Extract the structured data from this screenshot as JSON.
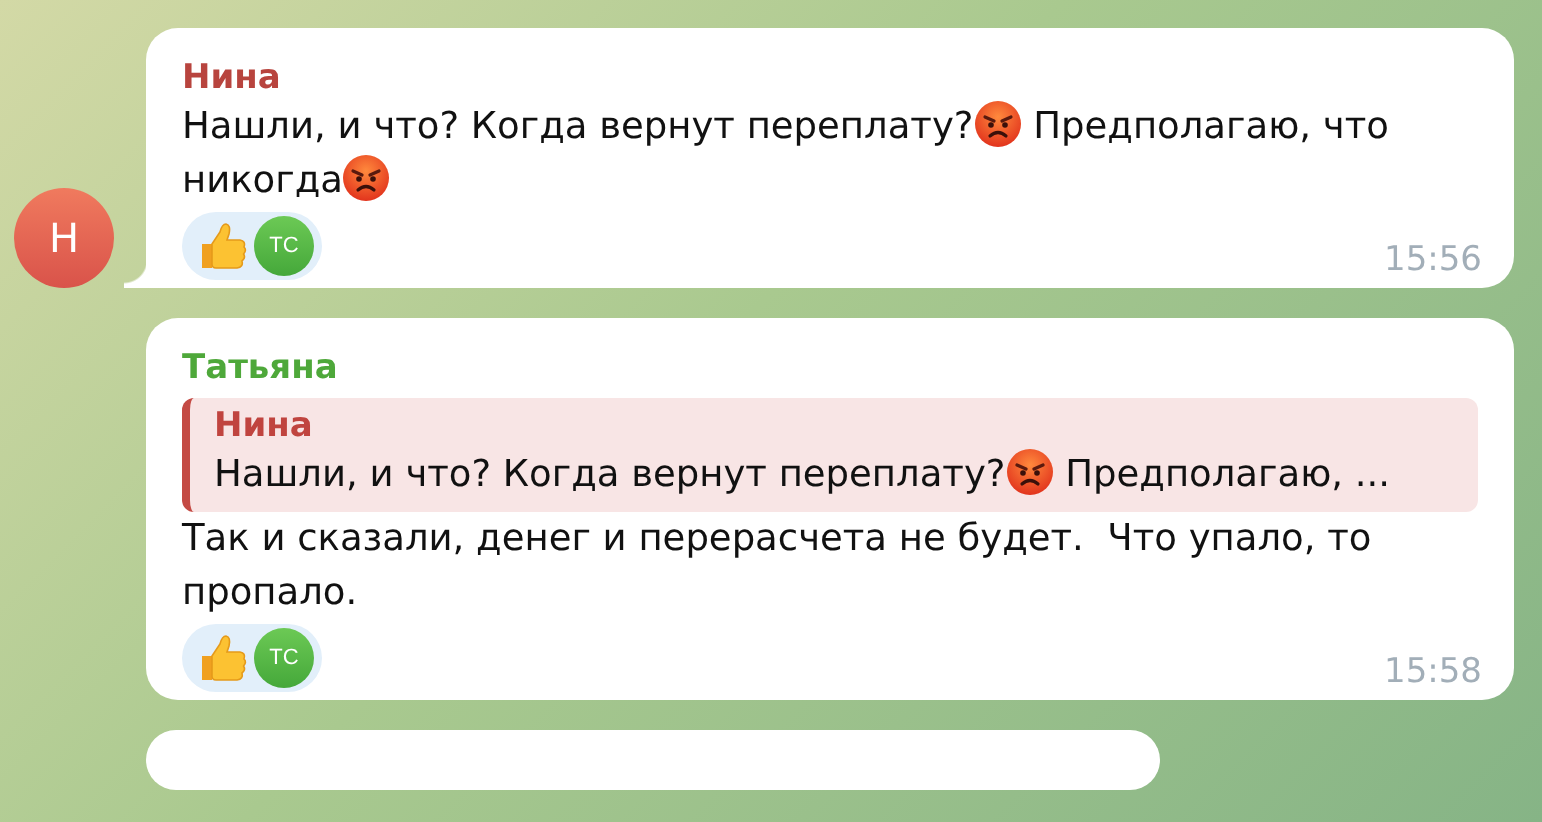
{
  "messages": [
    {
      "sender": "Нина",
      "color": "#b8443e",
      "avatar": {
        "initial": "Н"
      },
      "lines": [
        [
          {
            "kind": "text",
            "text": "Нашли, и что? Когда вернут переплату?"
          },
          {
            "kind": "emoji"
          },
          {
            "kind": "text",
            "text": " Предполагаю, что"
          }
        ],
        [
          {
            "kind": "text",
            "text": "никогда"
          },
          {
            "kind": "emoji"
          }
        ]
      ],
      "reactions": [
        {
          "initials": "ТС"
        }
      ],
      "time": "15:56"
    },
    {
      "sender": "Татьяна",
      "color": "#4ea83a",
      "reply": {
        "sender": "Нина",
        "parts": [
          {
            "kind": "text",
            "text": "Нашли, и что? Когда вернут переплату?"
          },
          {
            "kind": "emoji"
          },
          {
            "kind": "text",
            "text": " Предполагаю, ..."
          }
        ]
      },
      "lines": [
        [
          {
            "kind": "text",
            "text": "Так и сказали, денег и перерасчета не будет.  Что упало, то пропало."
          }
        ]
      ],
      "reactions": [
        {
          "initials": "ТС"
        }
      ],
      "time": "15:58"
    }
  ]
}
